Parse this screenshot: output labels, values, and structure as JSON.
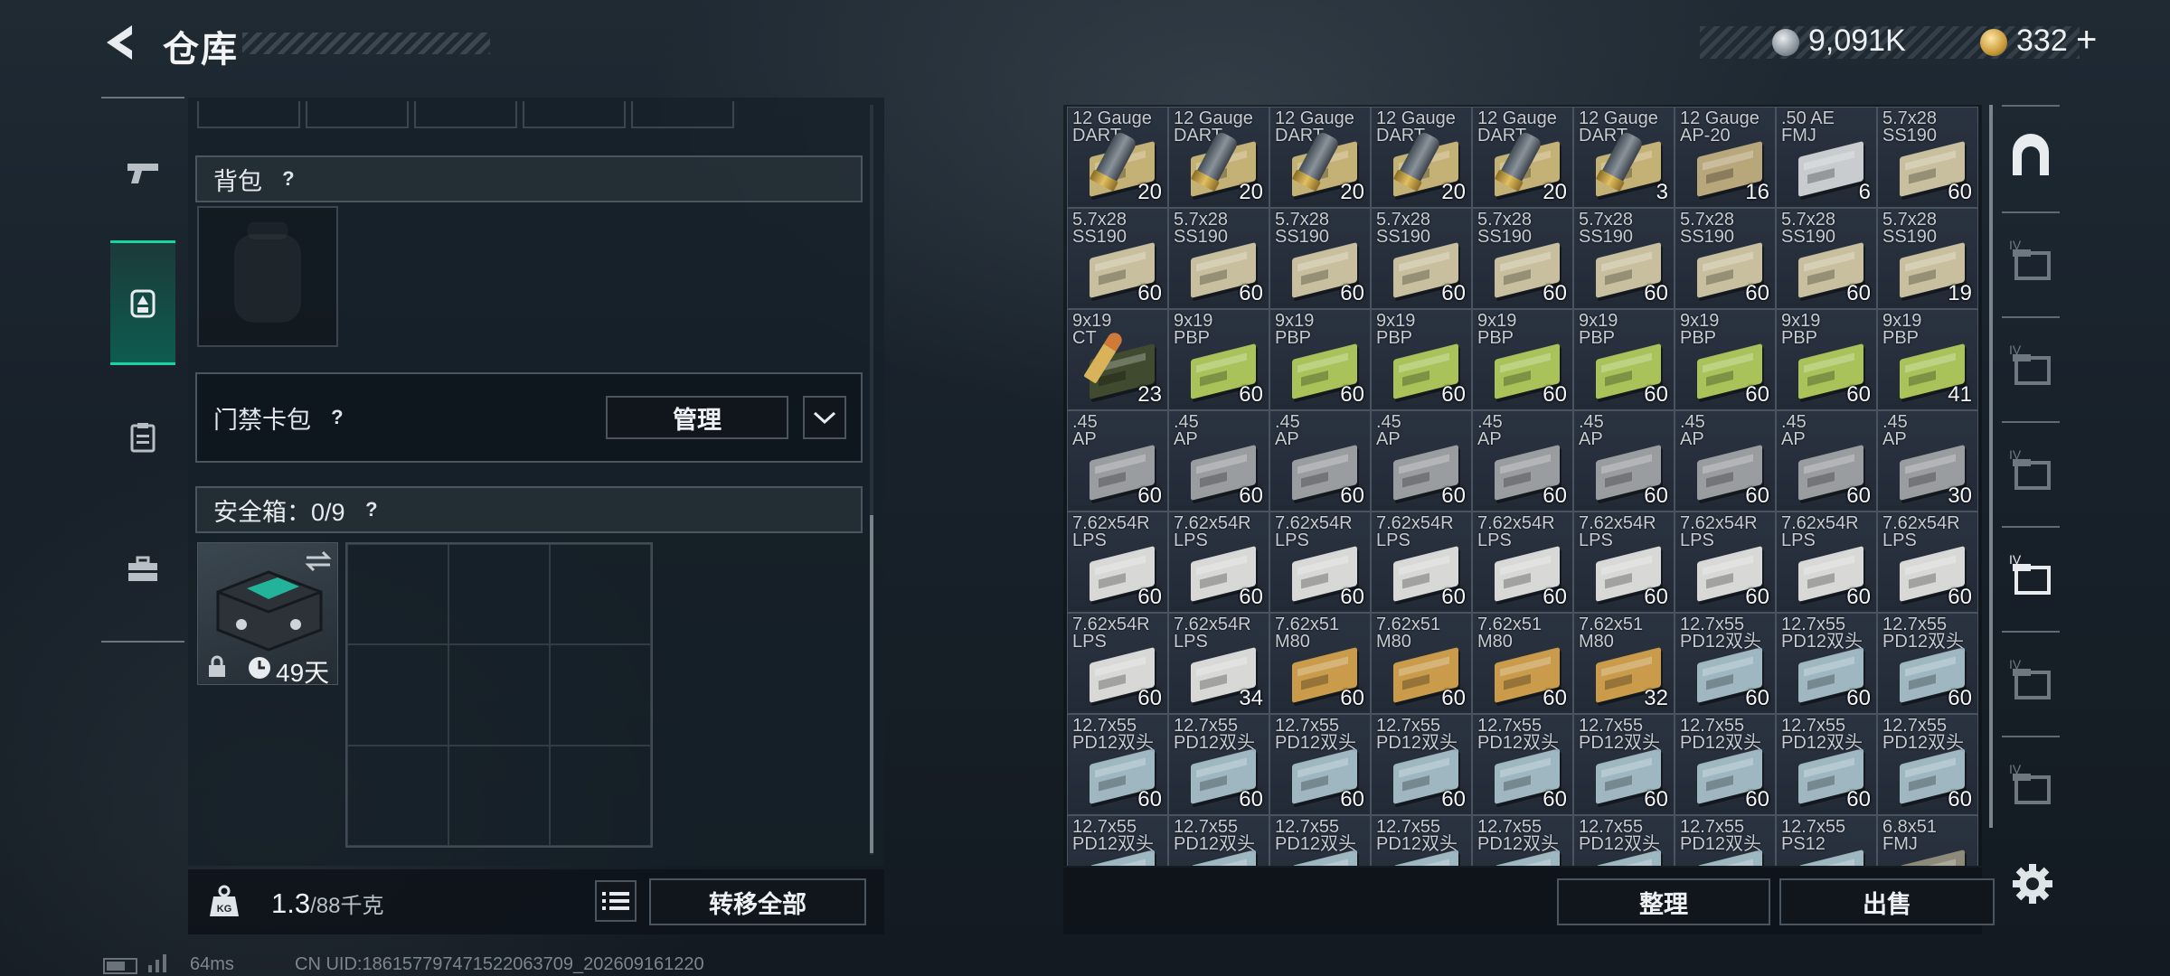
{
  "header": {
    "title": "仓库",
    "silver_amount": "9,091K",
    "gold_amount": "332",
    "gold_plus": "+"
  },
  "left_tabs": [
    {
      "name": "weapons",
      "icon": "pistol-icon",
      "active": false
    },
    {
      "name": "equipment",
      "icon": "backpack-gear-icon",
      "active": true
    },
    {
      "name": "clipboard",
      "icon": "clipboard-icon",
      "active": false
    },
    {
      "name": "toolbox",
      "icon": "toolbox-icon",
      "active": false
    }
  ],
  "backpack": {
    "label": "背包",
    "help": "?"
  },
  "keycard": {
    "label": "门禁卡包",
    "help": "?",
    "manage_label": "管理"
  },
  "safebox": {
    "label": "安全箱：0/9",
    "help": "?",
    "days_label": "49天"
  },
  "weight": {
    "current": "1.3",
    "max": "/88千克"
  },
  "buttons": {
    "transfer_all": "转移全部",
    "sort": "整理",
    "sell": "出售"
  },
  "status": {
    "ping": "64ms",
    "uid": "CN UID:18615779747152206370​9_202609161220"
  },
  "colors": {
    "accent": "#18d4a4",
    "panel": "#162028"
  },
  "inventory": [
    {
      "name": "12 Gauge\nDART",
      "count": "20",
      "kind": "shell",
      "color": "#c4b176"
    },
    {
      "name": "12 Gauge\nDART",
      "count": "20",
      "kind": "shell",
      "color": "#c4b176"
    },
    {
      "name": "12 Gauge\nDART",
      "count": "20",
      "kind": "shell",
      "color": "#c4b176"
    },
    {
      "name": "12 Gauge\nDART",
      "count": "20",
      "kind": "shell",
      "color": "#c4b176"
    },
    {
      "name": "12 Gauge\nDART",
      "count": "20",
      "kind": "shell",
      "color": "#c4b176"
    },
    {
      "name": "12 Gauge\nDART",
      "count": "3",
      "kind": "shell",
      "color": "#c4b176"
    },
    {
      "name": "12 Gauge\nAP-20",
      "count": "16",
      "kind": "box",
      "color": "#b9a77c"
    },
    {
      "name": ".50 AE\nFMJ",
      "count": "6",
      "kind": "box",
      "color": "#c9ccce"
    },
    {
      "name": "5.7x28\nSS190",
      "count": "60",
      "kind": "box",
      "color": "#c7bf9e"
    },
    {
      "name": "5.7x28\nSS190",
      "count": "60",
      "kind": "box",
      "color": "#c7bf9e"
    },
    {
      "name": "5.7x28\nSS190",
      "count": "60",
      "kind": "box",
      "color": "#c7bf9e"
    },
    {
      "name": "5.7x28\nSS190",
      "count": "60",
      "kind": "box",
      "color": "#c7bf9e"
    },
    {
      "name": "5.7x28\nSS190",
      "count": "60",
      "kind": "box",
      "color": "#c7bf9e"
    },
    {
      "name": "5.7x28\nSS190",
      "count": "60",
      "kind": "box",
      "color": "#c7bf9e"
    },
    {
      "name": "5.7x28\nSS190",
      "count": "60",
      "kind": "box",
      "color": "#c7bf9e"
    },
    {
      "name": "5.7x28\nSS190",
      "count": "60",
      "kind": "box",
      "color": "#c7bf9e"
    },
    {
      "name": "5.7x28\nSS190",
      "count": "60",
      "kind": "box",
      "color": "#c7bf9e"
    },
    {
      "name": "5.7x28\nSS190",
      "count": "19",
      "kind": "box",
      "color": "#c7bf9e"
    },
    {
      "name": "9x19\nCT",
      "count": "23",
      "kind": "bullet",
      "color": "#3f4a2e"
    },
    {
      "name": "9x19\nPBP",
      "count": "60",
      "kind": "box",
      "color": "#a9c35a"
    },
    {
      "name": "9x19\nPBP",
      "count": "60",
      "kind": "box",
      "color": "#a9c35a"
    },
    {
      "name": "9x19\nPBP",
      "count": "60",
      "kind": "box",
      "color": "#a9c35a"
    },
    {
      "name": "9x19\nPBP",
      "count": "60",
      "kind": "box",
      "color": "#a9c35a"
    },
    {
      "name": "9x19\nPBP",
      "count": "60",
      "kind": "box",
      "color": "#a9c35a"
    },
    {
      "name": "9x19\nPBP",
      "count": "60",
      "kind": "box",
      "color": "#a9c35a"
    },
    {
      "name": "9x19\nPBP",
      "count": "60",
      "kind": "box",
      "color": "#a9c35a"
    },
    {
      "name": "9x19\nPBP",
      "count": "41",
      "kind": "box",
      "color": "#a9c35a"
    },
    {
      "name": ".45\nAP",
      "count": "60",
      "kind": "box",
      "color": "#9a9d9f"
    },
    {
      "name": ".45\nAP",
      "count": "60",
      "kind": "box",
      "color": "#9a9d9f"
    },
    {
      "name": ".45\nAP",
      "count": "60",
      "kind": "box",
      "color": "#9a9d9f"
    },
    {
      "name": ".45\nAP",
      "count": "60",
      "kind": "box",
      "color": "#9a9d9f"
    },
    {
      "name": ".45\nAP",
      "count": "60",
      "kind": "box",
      "color": "#9a9d9f"
    },
    {
      "name": ".45\nAP",
      "count": "60",
      "kind": "box",
      "color": "#9a9d9f"
    },
    {
      "name": ".45\nAP",
      "count": "60",
      "kind": "box",
      "color": "#9a9d9f"
    },
    {
      "name": ".45\nAP",
      "count": "60",
      "kind": "box",
      "color": "#9a9d9f"
    },
    {
      "name": ".45\nAP",
      "count": "30",
      "kind": "box",
      "color": "#9a9d9f"
    },
    {
      "name": "7.62x54R\nLPS",
      "count": "60",
      "kind": "box",
      "color": "#d8d8d6"
    },
    {
      "name": "7.62x54R\nLPS",
      "count": "60",
      "kind": "box",
      "color": "#d8d8d6"
    },
    {
      "name": "7.62x54R\nLPS",
      "count": "60",
      "kind": "box",
      "color": "#d8d8d6"
    },
    {
      "name": "7.62x54R\nLPS",
      "count": "60",
      "kind": "box",
      "color": "#d8d8d6"
    },
    {
      "name": "7.62x54R\nLPS",
      "count": "60",
      "kind": "box",
      "color": "#d8d8d6"
    },
    {
      "name": "7.62x54R\nLPS",
      "count": "60",
      "kind": "box",
      "color": "#d8d8d6"
    },
    {
      "name": "7.62x54R\nLPS",
      "count": "60",
      "kind": "box",
      "color": "#d8d8d6"
    },
    {
      "name": "7.62x54R\nLPS",
      "count": "60",
      "kind": "box",
      "color": "#d8d8d6"
    },
    {
      "name": "7.62x54R\nLPS",
      "count": "60",
      "kind": "box",
      "color": "#d8d8d6"
    },
    {
      "name": "7.62x54R\nLPS",
      "count": "60",
      "kind": "box",
      "color": "#d8d8d6"
    },
    {
      "name": "7.62x54R\nLPS",
      "count": "34",
      "kind": "box",
      "color": "#d8d8d6"
    },
    {
      "name": "7.62x51\nM80",
      "count": "60",
      "kind": "box",
      "color": "#c99b4a"
    },
    {
      "name": "7.62x51\nM80",
      "count": "60",
      "kind": "box",
      "color": "#c99b4a"
    },
    {
      "name": "7.62x51\nM80",
      "count": "60",
      "kind": "box",
      "color": "#c99b4a"
    },
    {
      "name": "7.62x51\nM80",
      "count": "32",
      "kind": "box",
      "color": "#c99b4a"
    },
    {
      "name": "12.7x55\nPD12双头",
      "count": "60",
      "kind": "box",
      "color": "#9fb7c0"
    },
    {
      "name": "12.7x55\nPD12双头",
      "count": "60",
      "kind": "box",
      "color": "#9fb7c0"
    },
    {
      "name": "12.7x55\nPD12双头",
      "count": "60",
      "kind": "box",
      "color": "#9fb7c0"
    },
    {
      "name": "12.7x55\nPD12双头",
      "count": "60",
      "kind": "box",
      "color": "#9fb7c0"
    },
    {
      "name": "12.7x55\nPD12双头",
      "count": "60",
      "kind": "box",
      "color": "#9fb7c0"
    },
    {
      "name": "12.7x55\nPD12双头",
      "count": "60",
      "kind": "box",
      "color": "#9fb7c0"
    },
    {
      "name": "12.7x55\nPD12双头",
      "count": "60",
      "kind": "box",
      "color": "#9fb7c0"
    },
    {
      "name": "12.7x55\nPD12双头",
      "count": "60",
      "kind": "box",
      "color": "#9fb7c0"
    },
    {
      "name": "12.7x55\nPD12双头",
      "count": "60",
      "kind": "box",
      "color": "#9fb7c0"
    },
    {
      "name": "12.7x55\nPD12双头",
      "count": "60",
      "kind": "box",
      "color": "#9fb7c0"
    },
    {
      "name": "12.7x55\nPD12双头",
      "count": "60",
      "kind": "box",
      "color": "#9fb7c0"
    },
    {
      "name": "12.7x55\nPD12双头",
      "count": "60",
      "kind": "box",
      "color": "#9fb7c0"
    },
    {
      "name": "12.7x55\nPD12双头",
      "count": "",
      "kind": "box",
      "color": "#9fb7c0"
    },
    {
      "name": "12.7x55\nPD12双头",
      "count": "",
      "kind": "box",
      "color": "#9fb7c0"
    },
    {
      "name": "12.7x55\nPD12双头",
      "count": "",
      "kind": "box",
      "color": "#9fb7c0"
    },
    {
      "name": "12.7x55\nPD12双头",
      "count": "",
      "kind": "box",
      "color": "#9fb7c0"
    },
    {
      "name": "12.7x55\nPD12双头",
      "count": "",
      "kind": "box",
      "color": "#9fb7c0"
    },
    {
      "name": "12.7x55\nPD12双头",
      "count": "",
      "kind": "box",
      "color": "#9fb7c0"
    },
    {
      "name": "12.7x55\nPD12双头",
      "count": "",
      "kind": "box",
      "color": "#9fb7c0"
    },
    {
      "name": "12.7x55\nPS12",
      "count": "",
      "kind": "box",
      "color": "#9fb7c0"
    },
    {
      "name": "6.8x51\nFMJ",
      "count": "",
      "kind": "box",
      "color": "#8e8a7a"
    }
  ],
  "right_rail": [
    {
      "name": "storage-tab-all",
      "icon": "archway-icon"
    },
    {
      "name": "storage-tab-1",
      "icon": "folder-stack-icon",
      "label": "IV"
    },
    {
      "name": "storage-tab-2",
      "icon": "folder-weapon-icon",
      "label": "IV"
    },
    {
      "name": "storage-tab-3",
      "icon": "folder-medical-icon",
      "label": "IV"
    },
    {
      "name": "storage-tab-4",
      "icon": "folder-stack-icon",
      "label": "IV"
    },
    {
      "name": "storage-tab-5",
      "icon": "folder-triangle-icon",
      "label": "IV"
    },
    {
      "name": "storage-tab-6",
      "icon": "folder-triangle-icon",
      "label": "IV"
    }
  ]
}
